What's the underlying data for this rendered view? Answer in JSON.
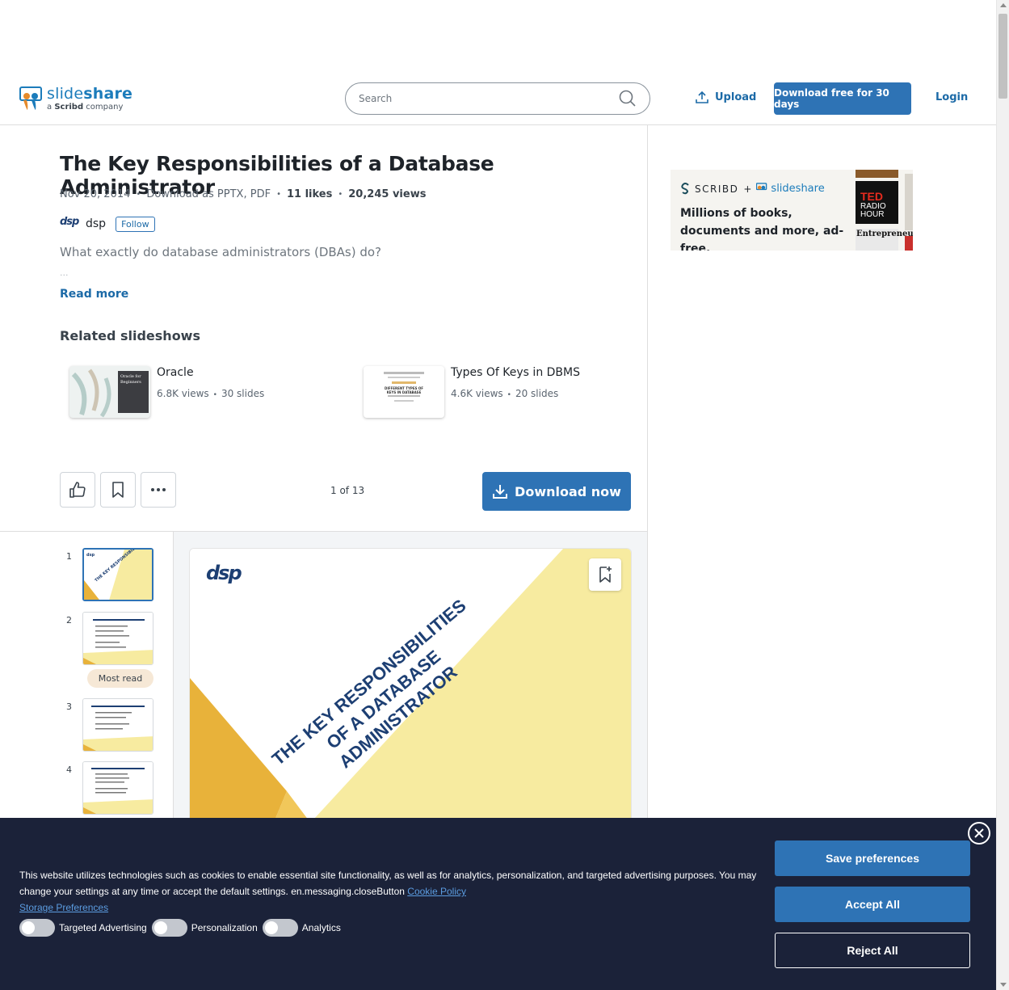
{
  "header": {
    "logo_name_light": "slide",
    "logo_name_bold": "share",
    "logo_sub_prefix": "a ",
    "logo_sub_bold": "Scribd",
    "logo_sub_suffix": " company",
    "search_placeholder": "Search",
    "upload_label": "Upload",
    "download_free_label": "Download free for 30 days",
    "login_label": "Login"
  },
  "document": {
    "title": "The Key Responsibilities of a Database Administrator",
    "date": "Nov 20, 2014",
    "download_as": "Download as PPTX, PDF",
    "likes": "11 likes",
    "views": "20,245 views",
    "author": "dsp",
    "author_avatar": "dsp",
    "follow_label": "Follow",
    "description": "What exactly do database administrators (DBAs) do?",
    "description_ellipsis": "...",
    "read_more": "Read more"
  },
  "related": {
    "heading": "Related slideshows",
    "items": [
      {
        "title": "Oracle",
        "views": "6.8K views",
        "slides": "30 slides",
        "thumb_title": "Oracle for Beginners"
      },
      {
        "title": "Types Of Keys in DBMS",
        "views": "4.6K views",
        "slides": "20 slides",
        "thumb_title": "DIFFERENT TYPES OF KEYS IN DATABASE"
      }
    ]
  },
  "toolbar": {
    "page_count": "1 of 13",
    "download_now": "Download now"
  },
  "viewer": {
    "thumbnails": [
      {
        "num": "1",
        "active": true
      },
      {
        "num": "2",
        "active": false
      },
      {
        "num": "3",
        "active": false
      },
      {
        "num": "4",
        "active": false
      }
    ],
    "most_read": "Most read",
    "slide_logo": "dsp",
    "slide_title_line1": "THE KEY RESPONSIBILITIES",
    "slide_title_line2": "OF A DATABASE ADMINISTRATOR"
  },
  "ad": {
    "scribd": "SCRIBD",
    "plus": "+",
    "slideshare": "slideshare",
    "text": "Millions of books, documents and more, ad-free."
  },
  "cookie": {
    "text": "This website utilizes technologies such as cookies to enable essential site functionality, as well as for analytics, personalization, and targeted advertising purposes. You may change your settings at any time or accept the default settings. en.messaging.closeButton ",
    "cookie_policy": "Cookie Policy",
    "storage_preferences": "Storage Preferences",
    "toggles": [
      "Targeted Advertising",
      "Personalization",
      "Analytics"
    ],
    "save_preferences": "Save preferences",
    "accept_all": "Accept All",
    "reject_all": "Reject All"
  },
  "colors": {
    "brand_blue": "#2e73b5",
    "link_blue": "#1c6aa7",
    "cookie_bg": "#1b2239",
    "slide_yellow": "#f7eba0",
    "slide_gold": "#e8b23a"
  }
}
